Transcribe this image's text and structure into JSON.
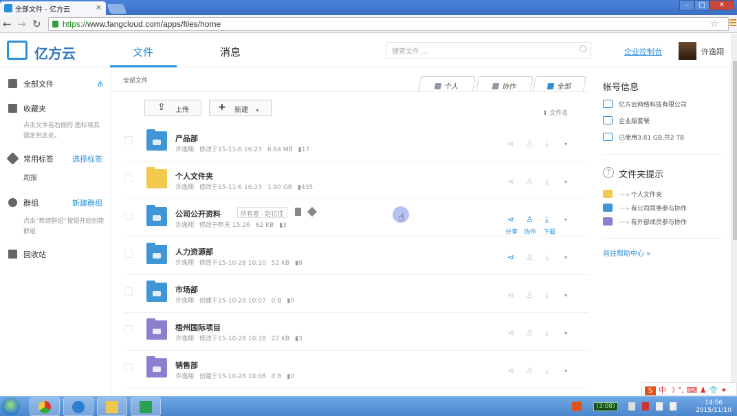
{
  "browser": {
    "tab_title": "全部文件 - 亿方云",
    "tab_close": "×",
    "url_scheme": "https://",
    "url_rest": "www.fangcloud.com/apps/files/home",
    "win_min": "–",
    "win_max": "□",
    "win_close": "✕",
    "star": "☆"
  },
  "app": {
    "logo_text": "亿方云",
    "nav_files": "文件",
    "nav_messages": "消息",
    "search_placeholder": "搜索文件 ...",
    "admin_console": "企业控制台",
    "username": "许逸翔"
  },
  "sidebar": {
    "all_files": "全部文件",
    "favorites": "收藏夹",
    "favorites_hint": "点击文件名右侧的 图标将其固定到此处。",
    "tags": "常用标签",
    "tags_action": "选择标签",
    "tag_item": "周报",
    "groups": "群组",
    "groups_action": "新建群组",
    "groups_hint": "点击“新建群组”按钮开始创建群组",
    "trash": "回收站"
  },
  "main": {
    "breadcrumb": "全部文件",
    "view_tabs": [
      "个人",
      "协作",
      "全部"
    ],
    "upload": "上传",
    "new": "新建",
    "sort_label": "文件名",
    "rows": [
      {
        "name": "产品部",
        "owner": "许逸翔",
        "action": "修改于15-11-6 16:23",
        "size": "6.64 MB",
        "count": "17",
        "folder_color": "#3f95d6"
      },
      {
        "name": "个人文件夹",
        "owner": "许逸翔",
        "action": "修改于15-11-6 16:23",
        "size": "1.90 GB",
        "count": "435",
        "folder_color": "#f2c94c"
      },
      {
        "name": "公司公开资料",
        "owner": "许逸翔",
        "action": "修改于昨天 15:26",
        "size": "62 KB",
        "count": "3",
        "folder_color": "#3f95d6",
        "tag": "所有者 · 赵亿佳",
        "share": "分享",
        "collab": "协作",
        "download": "下载"
      },
      {
        "name": "人力资源部",
        "owner": "许逸翔",
        "action": "修改于15-10-28 10:10",
        "size": "52 KB",
        "count": "8",
        "folder_color": "#3f95d6"
      },
      {
        "name": "市场部",
        "owner": "许逸翔",
        "action": "创建于15-10-28 10:07",
        "size": "0 B",
        "count": "0",
        "folder_color": "#3f95d6"
      },
      {
        "name": "梧州国际项目",
        "owner": "许逸翔",
        "action": "修改于15-10-28 10:18",
        "size": "22 KB",
        "count": "3",
        "folder_color": "#8b7fd0"
      },
      {
        "name": "销售部",
        "owner": "许逸翔",
        "action": "创建于15-10-28 10:08",
        "size": "0 B",
        "count": "0",
        "folder_color": "#8b7fd0"
      }
    ]
  },
  "right": {
    "account_title": "帐号信息",
    "company": "亿方云网络科技有限公司",
    "plan": "企业版套餐",
    "usage": "已使用3.81 GB,共2 TB",
    "tips_title": "文件夹提示",
    "tips": [
      "····› 个人文件夹",
      "····› 有公司同事参与协作",
      "····› 有外部成员参与协作"
    ],
    "help_link": "前往帮助中心 »"
  },
  "taskbar": {
    "battery": "(3:08)",
    "time": "14:56",
    "date": "2015/11/10",
    "ime": "中 ☽ °, ⌨ ♟ 👕 ✦"
  },
  "colors": {
    "accent": "#2a8fd8",
    "folder_blue": "#3f95d6",
    "folder_yellow": "#f2c94c",
    "folder_purple": "#8b7fd0"
  }
}
